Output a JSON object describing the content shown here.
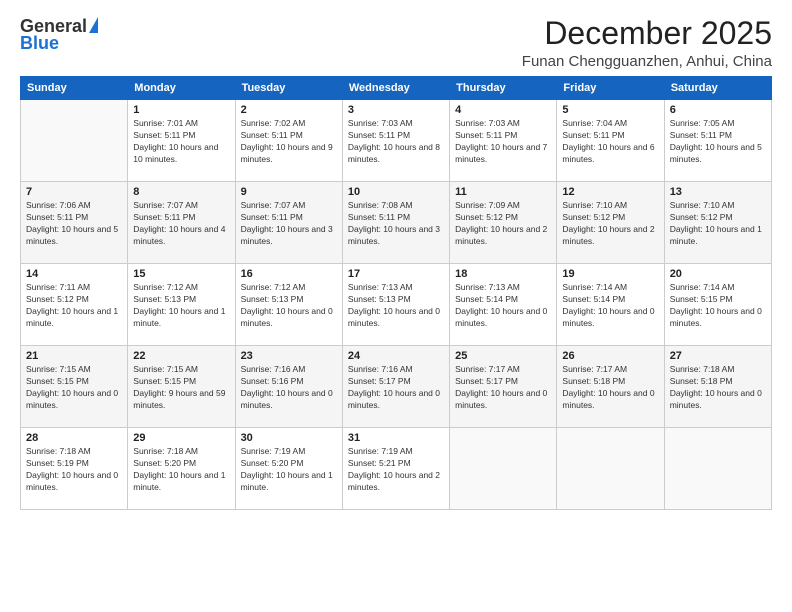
{
  "header": {
    "logo_general": "General",
    "logo_blue": "Blue",
    "month_title": "December 2025",
    "location": "Funan Chengguanzhen, Anhui, China"
  },
  "weekdays": [
    "Sunday",
    "Monday",
    "Tuesday",
    "Wednesday",
    "Thursday",
    "Friday",
    "Saturday"
  ],
  "weeks": [
    [
      {
        "day": "",
        "sunrise": "",
        "sunset": "",
        "daylight": ""
      },
      {
        "day": "1",
        "sunrise": "Sunrise: 7:01 AM",
        "sunset": "Sunset: 5:11 PM",
        "daylight": "Daylight: 10 hours and 10 minutes."
      },
      {
        "day": "2",
        "sunrise": "Sunrise: 7:02 AM",
        "sunset": "Sunset: 5:11 PM",
        "daylight": "Daylight: 10 hours and 9 minutes."
      },
      {
        "day": "3",
        "sunrise": "Sunrise: 7:03 AM",
        "sunset": "Sunset: 5:11 PM",
        "daylight": "Daylight: 10 hours and 8 minutes."
      },
      {
        "day": "4",
        "sunrise": "Sunrise: 7:03 AM",
        "sunset": "Sunset: 5:11 PM",
        "daylight": "Daylight: 10 hours and 7 minutes."
      },
      {
        "day": "5",
        "sunrise": "Sunrise: 7:04 AM",
        "sunset": "Sunset: 5:11 PM",
        "daylight": "Daylight: 10 hours and 6 minutes."
      },
      {
        "day": "6",
        "sunrise": "Sunrise: 7:05 AM",
        "sunset": "Sunset: 5:11 PM",
        "daylight": "Daylight: 10 hours and 5 minutes."
      }
    ],
    [
      {
        "day": "7",
        "sunrise": "Sunrise: 7:06 AM",
        "sunset": "Sunset: 5:11 PM",
        "daylight": "Daylight: 10 hours and 5 minutes."
      },
      {
        "day": "8",
        "sunrise": "Sunrise: 7:07 AM",
        "sunset": "Sunset: 5:11 PM",
        "daylight": "Daylight: 10 hours and 4 minutes."
      },
      {
        "day": "9",
        "sunrise": "Sunrise: 7:07 AM",
        "sunset": "Sunset: 5:11 PM",
        "daylight": "Daylight: 10 hours and 3 minutes."
      },
      {
        "day": "10",
        "sunrise": "Sunrise: 7:08 AM",
        "sunset": "Sunset: 5:11 PM",
        "daylight": "Daylight: 10 hours and 3 minutes."
      },
      {
        "day": "11",
        "sunrise": "Sunrise: 7:09 AM",
        "sunset": "Sunset: 5:12 PM",
        "daylight": "Daylight: 10 hours and 2 minutes."
      },
      {
        "day": "12",
        "sunrise": "Sunrise: 7:10 AM",
        "sunset": "Sunset: 5:12 PM",
        "daylight": "Daylight: 10 hours and 2 minutes."
      },
      {
        "day": "13",
        "sunrise": "Sunrise: 7:10 AM",
        "sunset": "Sunset: 5:12 PM",
        "daylight": "Daylight: 10 hours and 1 minute."
      }
    ],
    [
      {
        "day": "14",
        "sunrise": "Sunrise: 7:11 AM",
        "sunset": "Sunset: 5:12 PM",
        "daylight": "Daylight: 10 hours and 1 minute."
      },
      {
        "day": "15",
        "sunrise": "Sunrise: 7:12 AM",
        "sunset": "Sunset: 5:13 PM",
        "daylight": "Daylight: 10 hours and 1 minute."
      },
      {
        "day": "16",
        "sunrise": "Sunrise: 7:12 AM",
        "sunset": "Sunset: 5:13 PM",
        "daylight": "Daylight: 10 hours and 0 minutes."
      },
      {
        "day": "17",
        "sunrise": "Sunrise: 7:13 AM",
        "sunset": "Sunset: 5:13 PM",
        "daylight": "Daylight: 10 hours and 0 minutes."
      },
      {
        "day": "18",
        "sunrise": "Sunrise: 7:13 AM",
        "sunset": "Sunset: 5:14 PM",
        "daylight": "Daylight: 10 hours and 0 minutes."
      },
      {
        "day": "19",
        "sunrise": "Sunrise: 7:14 AM",
        "sunset": "Sunset: 5:14 PM",
        "daylight": "Daylight: 10 hours and 0 minutes."
      },
      {
        "day": "20",
        "sunrise": "Sunrise: 7:14 AM",
        "sunset": "Sunset: 5:15 PM",
        "daylight": "Daylight: 10 hours and 0 minutes."
      }
    ],
    [
      {
        "day": "21",
        "sunrise": "Sunrise: 7:15 AM",
        "sunset": "Sunset: 5:15 PM",
        "daylight": "Daylight: 10 hours and 0 minutes."
      },
      {
        "day": "22",
        "sunrise": "Sunrise: 7:15 AM",
        "sunset": "Sunset: 5:15 PM",
        "daylight": "Daylight: 9 hours and 59 minutes."
      },
      {
        "day": "23",
        "sunrise": "Sunrise: 7:16 AM",
        "sunset": "Sunset: 5:16 PM",
        "daylight": "Daylight: 10 hours and 0 minutes."
      },
      {
        "day": "24",
        "sunrise": "Sunrise: 7:16 AM",
        "sunset": "Sunset: 5:17 PM",
        "daylight": "Daylight: 10 hours and 0 minutes."
      },
      {
        "day": "25",
        "sunrise": "Sunrise: 7:17 AM",
        "sunset": "Sunset: 5:17 PM",
        "daylight": "Daylight: 10 hours and 0 minutes."
      },
      {
        "day": "26",
        "sunrise": "Sunrise: 7:17 AM",
        "sunset": "Sunset: 5:18 PM",
        "daylight": "Daylight: 10 hours and 0 minutes."
      },
      {
        "day": "27",
        "sunrise": "Sunrise: 7:18 AM",
        "sunset": "Sunset: 5:18 PM",
        "daylight": "Daylight: 10 hours and 0 minutes."
      }
    ],
    [
      {
        "day": "28",
        "sunrise": "Sunrise: 7:18 AM",
        "sunset": "Sunset: 5:19 PM",
        "daylight": "Daylight: 10 hours and 0 minutes."
      },
      {
        "day": "29",
        "sunrise": "Sunrise: 7:18 AM",
        "sunset": "Sunset: 5:20 PM",
        "daylight": "Daylight: 10 hours and 1 minute."
      },
      {
        "day": "30",
        "sunrise": "Sunrise: 7:19 AM",
        "sunset": "Sunset: 5:20 PM",
        "daylight": "Daylight: 10 hours and 1 minute."
      },
      {
        "day": "31",
        "sunrise": "Sunrise: 7:19 AM",
        "sunset": "Sunset: 5:21 PM",
        "daylight": "Daylight: 10 hours and 2 minutes."
      },
      {
        "day": "",
        "sunrise": "",
        "sunset": "",
        "daylight": ""
      },
      {
        "day": "",
        "sunrise": "",
        "sunset": "",
        "daylight": ""
      },
      {
        "day": "",
        "sunrise": "",
        "sunset": "",
        "daylight": ""
      }
    ]
  ]
}
